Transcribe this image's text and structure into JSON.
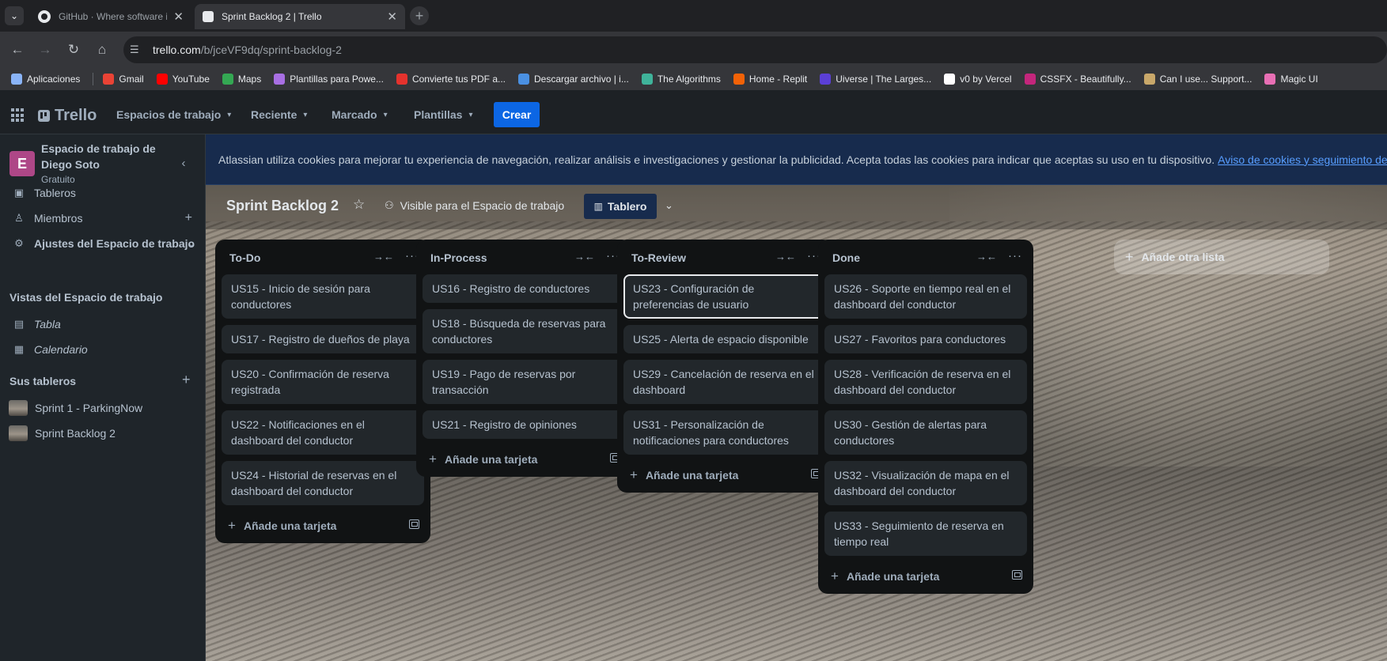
{
  "browser": {
    "tabs": [
      {
        "title": "GitHub · Where software is built",
        "active": false
      },
      {
        "title": "Sprint Backlog 2 | Trello",
        "active": true
      }
    ],
    "url_domain": "trello.com",
    "url_path": "/b/jceVF9dq/sprint-backlog-2",
    "bookmarks": [
      {
        "label": "Aplicaciones",
        "icon": "apps-grid-icon",
        "color": "#8ab4f8"
      },
      {
        "label": "Gmail",
        "icon": "gmail-icon",
        "color": "#ea4335"
      },
      {
        "label": "YouTube",
        "icon": "youtube-icon",
        "color": "#ff0000"
      },
      {
        "label": "Maps",
        "icon": "maps-icon",
        "color": "#34a853"
      },
      {
        "label": "Plantillas para Powe...",
        "icon": "slides-icon",
        "color": "#a86fe3"
      },
      {
        "label": "Convierte tus PDF a...",
        "icon": "heart-icon",
        "color": "#e5322d"
      },
      {
        "label": "Descargar archivo | i...",
        "icon": "diamond-icon",
        "color": "#4a90e2"
      },
      {
        "label": "The Algorithms",
        "icon": "algorithms-icon",
        "color": "#3fb39a"
      },
      {
        "label": "Home - Replit",
        "icon": "replit-icon",
        "color": "#f26207"
      },
      {
        "label": "Uiverse | The Larges...",
        "icon": "uiverse-icon",
        "color": "#5b3fd6"
      },
      {
        "label": "v0 by Vercel",
        "icon": "v0-icon",
        "color": "#ffffff"
      },
      {
        "label": "CSSFX - Beautifully...",
        "icon": "cssfx-icon",
        "color": "#c4267c"
      },
      {
        "label": "Can I use... Support...",
        "icon": "caniuse-icon",
        "color": "#c9a86a"
      },
      {
        "label": "Magic UI",
        "icon": "magicui-icon",
        "color": "#e86fb4"
      }
    ]
  },
  "header": {
    "logo": "Trello",
    "menus": [
      "Espacios de trabajo",
      "Reciente",
      "Marcado",
      "Plantillas"
    ],
    "create_label": "Crear"
  },
  "sidebar": {
    "workspace_initial": "E",
    "workspace_name": "Espacio de trabajo de Diego Soto",
    "workspace_plan": "Gratuito",
    "items": [
      {
        "label": "Tableros",
        "icon": "board-icon"
      },
      {
        "label": "Miembros",
        "icon": "person-icon"
      },
      {
        "label": "Ajustes del Espacio de trabajo",
        "icon": "gear-icon"
      }
    ],
    "views_heading": "Vistas del Espacio de trabajo",
    "views": [
      {
        "label": "Tabla",
        "icon": "table-icon"
      },
      {
        "label": "Calendario",
        "icon": "calendar-icon"
      }
    ],
    "boards_heading": "Sus tableros",
    "boards": [
      "Sprint 1 - ParkingNow",
      "Sprint Backlog 2"
    ]
  },
  "cookie_banner": {
    "text": "Atlassian utiliza cookies para mejorar tu experiencia de navegación, realizar análisis e investigaciones y gestionar la publicidad. Acepta todas las cookies para indicar que aceptas su uso en tu dispositivo.",
    "link": "Aviso de cookies y seguimiento de Atlassian"
  },
  "board": {
    "title": "Sprint Backlog 2",
    "visibility": "Visible para el Espacio de trabajo",
    "view": "Tablero",
    "add_card_label": "Añade una tarjeta",
    "add_list_label": "Añade otra lista",
    "lists": [
      {
        "name": "To-Do",
        "cards": [
          "US15 - Inicio de sesión para conductores",
          "US17 - Registro de dueños de playa",
          "US20 - Confirmación de reserva registrada",
          "US22 - Notificaciones en el dashboard del conductor",
          "US24 - Historial de reservas en el dashboard del conductor"
        ]
      },
      {
        "name": "In-Process",
        "cards": [
          "US16 - Registro de conductores",
          "US18 - Búsqueda de reservas para conductores",
          "US19 - Pago de reservas por transacción",
          "US21 - Registro de opiniones"
        ]
      },
      {
        "name": "To-Review",
        "cards": [
          "US23 - Configuración de preferencias de usuario",
          "US25 - Alerta de espacio disponible",
          "US29 - Cancelación de reserva en el dashboard",
          "US31 - Personalización de notificaciones para conductores"
        ],
        "selected_card": 0
      },
      {
        "name": "Done",
        "cards": [
          "US26 - Soporte en tiempo real en el dashboard del conductor",
          "US27 - Favoritos para conductores",
          "US28 - Verificación de reserva en el dashboard del conductor",
          "US30 - Gestión de alertas para conductores",
          "US32 - Visualización de mapa en el dashboard del conductor",
          "US33 - Seguimiento de reserva en tiempo real"
        ]
      }
    ]
  }
}
